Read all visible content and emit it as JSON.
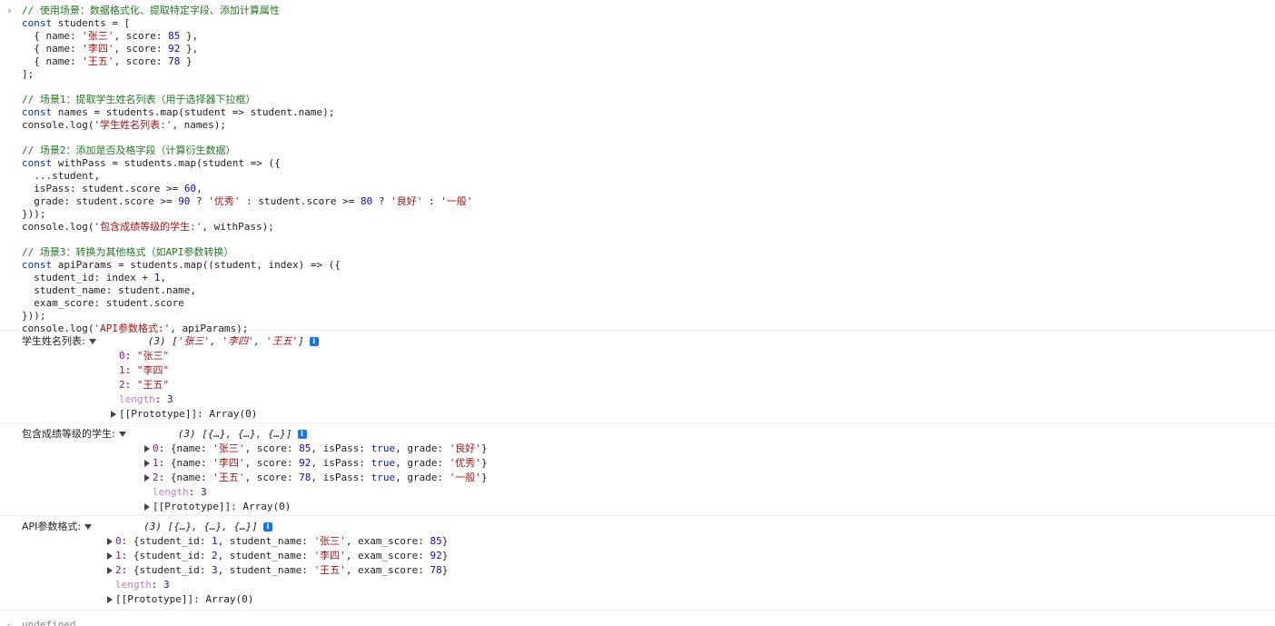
{
  "input_code": {
    "lines": [
      [
        {
          "t": "cm",
          "v": "// 使用场景：数据格式化、提取特定字段、添加计算属性"
        }
      ],
      [
        {
          "t": "kw",
          "v": "const"
        },
        {
          "t": "plain",
          "v": " students = ["
        }
      ],
      [
        {
          "t": "plain",
          "v": "  { name: "
        },
        {
          "t": "str",
          "v": "'张三'"
        },
        {
          "t": "plain",
          "v": ", score: "
        },
        {
          "t": "num",
          "v": "85"
        },
        {
          "t": "plain",
          "v": " },"
        }
      ],
      [
        {
          "t": "plain",
          "v": "  { name: "
        },
        {
          "t": "str",
          "v": "'李四'"
        },
        {
          "t": "plain",
          "v": ", score: "
        },
        {
          "t": "num",
          "v": "92"
        },
        {
          "t": "plain",
          "v": " },"
        }
      ],
      [
        {
          "t": "plain",
          "v": "  { name: "
        },
        {
          "t": "str",
          "v": "'王五'"
        },
        {
          "t": "plain",
          "v": ", score: "
        },
        {
          "t": "num",
          "v": "78"
        },
        {
          "t": "plain",
          "v": " }"
        }
      ],
      [
        {
          "t": "plain",
          "v": "];"
        }
      ],
      [
        {
          "t": "plain",
          "v": ""
        }
      ],
      [
        {
          "t": "cm",
          "v": "// 场景1：提取学生姓名列表（用于选择器下拉框）"
        }
      ],
      [
        {
          "t": "kw",
          "v": "const"
        },
        {
          "t": "plain",
          "v": " names = students.map(student => student.name);"
        }
      ],
      [
        {
          "t": "plain",
          "v": "console.log("
        },
        {
          "t": "str",
          "v": "'学生姓名列表:'"
        },
        {
          "t": "plain",
          "v": ", names);"
        }
      ],
      [
        {
          "t": "plain",
          "v": ""
        }
      ],
      [
        {
          "t": "cm",
          "v": "// 场景2：添加是否及格字段（计算衍生数据）"
        }
      ],
      [
        {
          "t": "kw",
          "v": "const"
        },
        {
          "t": "plain",
          "v": " withPass = students.map(student => ({"
        }
      ],
      [
        {
          "t": "plain",
          "v": "  ...student,"
        }
      ],
      [
        {
          "t": "plain",
          "v": "  isPass: student.score >= "
        },
        {
          "t": "num",
          "v": "60"
        },
        {
          "t": "plain",
          "v": ","
        }
      ],
      [
        {
          "t": "plain",
          "v": "  grade: student.score >= "
        },
        {
          "t": "num",
          "v": "90"
        },
        {
          "t": "plain",
          "v": " ? "
        },
        {
          "t": "str",
          "v": "'优秀'"
        },
        {
          "t": "plain",
          "v": " : student.score >= "
        },
        {
          "t": "num",
          "v": "80"
        },
        {
          "t": "plain",
          "v": " ? "
        },
        {
          "t": "str",
          "v": "'良好'"
        },
        {
          "t": "plain",
          "v": " : "
        },
        {
          "t": "str",
          "v": "'一般'"
        }
      ],
      [
        {
          "t": "plain",
          "v": "}));"
        }
      ],
      [
        {
          "t": "plain",
          "v": "console.log("
        },
        {
          "t": "str",
          "v": "'包含成绩等级的学生:'"
        },
        {
          "t": "plain",
          "v": ", withPass);"
        }
      ],
      [
        {
          "t": "plain",
          "v": ""
        }
      ],
      [
        {
          "t": "cm",
          "v": "// 场景3：转换为其他格式（如API参数转换）"
        }
      ],
      [
        {
          "t": "kw",
          "v": "const"
        },
        {
          "t": "plain",
          "v": " apiParams = students.map((student, index) => ({"
        }
      ],
      [
        {
          "t": "plain",
          "v": "  student_id: index + "
        },
        {
          "t": "num",
          "v": "1"
        },
        {
          "t": "plain",
          "v": ","
        }
      ],
      [
        {
          "t": "plain",
          "v": "  student_name: student.name,"
        }
      ],
      [
        {
          "t": "plain",
          "v": "  exam_score: student.score"
        }
      ],
      [
        {
          "t": "plain",
          "v": "}));"
        }
      ],
      [
        {
          "t": "plain",
          "v": "console.log("
        },
        {
          "t": "str",
          "v": "'API参数格式:'"
        },
        {
          "t": "plain",
          "v": ", apiParams);"
        }
      ]
    ]
  },
  "logs": [
    {
      "label": "学生姓名列表:",
      "preview": "(3) ['张三', '李四', '王五']",
      "rows": [
        {
          "key": "0",
          "value": "\"张三\"",
          "vt": "sstr",
          "expand": false
        },
        {
          "key": "1",
          "value": "\"李四\"",
          "vt": "sstr",
          "expand": false
        },
        {
          "key": "2",
          "value": "\"王五\"",
          "vt": "sstr",
          "expand": false
        },
        {
          "key": "length",
          "value": "3",
          "vt": "snum",
          "expand": false,
          "dim": true
        },
        {
          "key": "[[Prototype]]",
          "value": "Array(0)",
          "vt": "proto",
          "expand": true,
          "proto": true
        }
      ]
    },
    {
      "label": "包含成绩等级的学生:",
      "preview": "(3) [{…}, {…}, {…}]",
      "rows": [
        {
          "key": "0",
          "value": "{name: '张三', score: 85, isPass: true, grade: '良好'}",
          "vt": "obj",
          "expand": true
        },
        {
          "key": "1",
          "value": "{name: '李四', score: 92, isPass: true, grade: '优秀'}",
          "vt": "obj",
          "expand": true
        },
        {
          "key": "2",
          "value": "{name: '王五', score: 78, isPass: true, grade: '一般'}",
          "vt": "obj",
          "expand": true
        },
        {
          "key": "length",
          "value": "3",
          "vt": "snum",
          "expand": false,
          "dim": true
        },
        {
          "key": "[[Prototype]]",
          "value": "Array(0)",
          "vt": "proto",
          "expand": true,
          "proto": true
        }
      ]
    },
    {
      "label": "API参数格式:",
      "preview": "(3) [{…}, {…}, {…}]",
      "rows": [
        {
          "key": "0",
          "value": "{student_id: 1, student_name: '张三', exam_score: 85}",
          "vt": "obj",
          "expand": true
        },
        {
          "key": "1",
          "value": "{student_id: 2, student_name: '李四', exam_score: 92}",
          "vt": "obj",
          "expand": true
        },
        {
          "key": "2",
          "value": "{student_id: 3, student_name: '王五', exam_score: 78}",
          "vt": "obj",
          "expand": true
        },
        {
          "key": "length",
          "value": "3",
          "vt": "snum",
          "expand": false,
          "dim": true
        },
        {
          "key": "[[Prototype]]",
          "value": "Array(0)",
          "vt": "proto",
          "expand": true,
          "proto": true
        }
      ]
    }
  ],
  "result": "undefined"
}
